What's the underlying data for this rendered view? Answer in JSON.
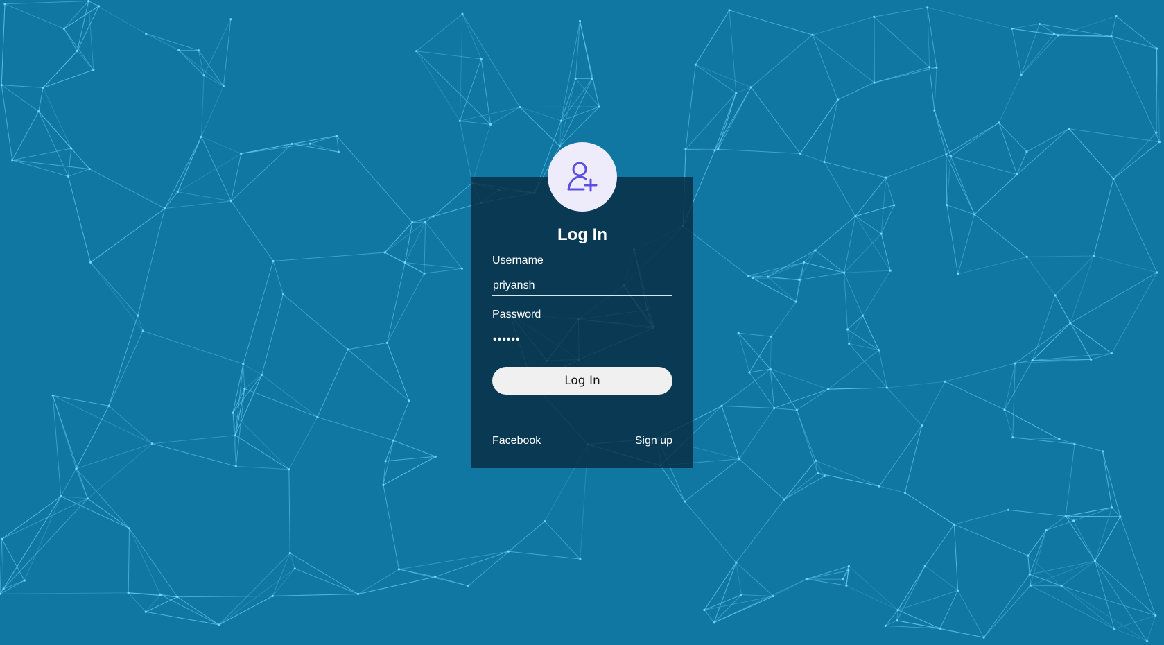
{
  "form": {
    "title": "Log In",
    "username_label": "Username",
    "username_value": "priyansh",
    "password_label": "Password",
    "password_value": "••••••",
    "submit_label": "Log In"
  },
  "links": {
    "facebook": "Facebook",
    "signup": "Sign up"
  },
  "icons": {
    "avatar": "user-plus-icon"
  },
  "colors": {
    "background": "#0f77a2",
    "card": "#0a2d42",
    "avatar_bg": "#eeecfb",
    "avatar_icon": "#5b4fe0",
    "network_lines": "#5fc6f0"
  }
}
